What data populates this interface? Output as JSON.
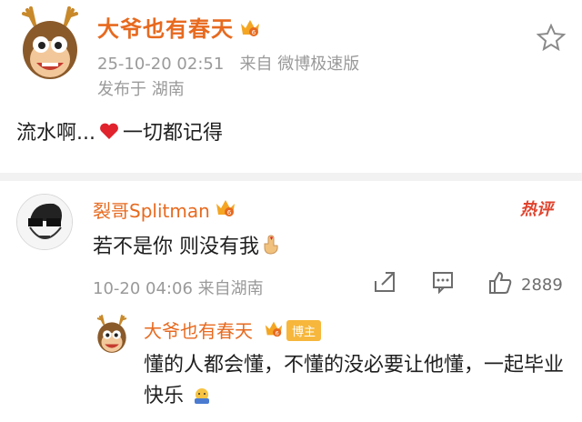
{
  "post": {
    "username": "大爷也有春天",
    "timestamp": "25-10-20 02:51",
    "source": "来自 微博极速版",
    "location": "发布于 湖南",
    "text_before": "流水啊...",
    "text_after": "一切都记得"
  },
  "comment": {
    "username": "裂哥Splitman",
    "hot_label": "热评",
    "text": "若不是你 则没有我",
    "meta": "10-20 04:06 来自湖南",
    "like_count": "2889"
  },
  "reply": {
    "username": "大爷也有春天",
    "badge": "博主",
    "text": "懂的人都会懂，不懂的没必要让他懂，一起毕业快乐"
  },
  "colors": {
    "username": "#e76a1f",
    "meta": "#9a9a9a",
    "heart": "#e0232d"
  }
}
